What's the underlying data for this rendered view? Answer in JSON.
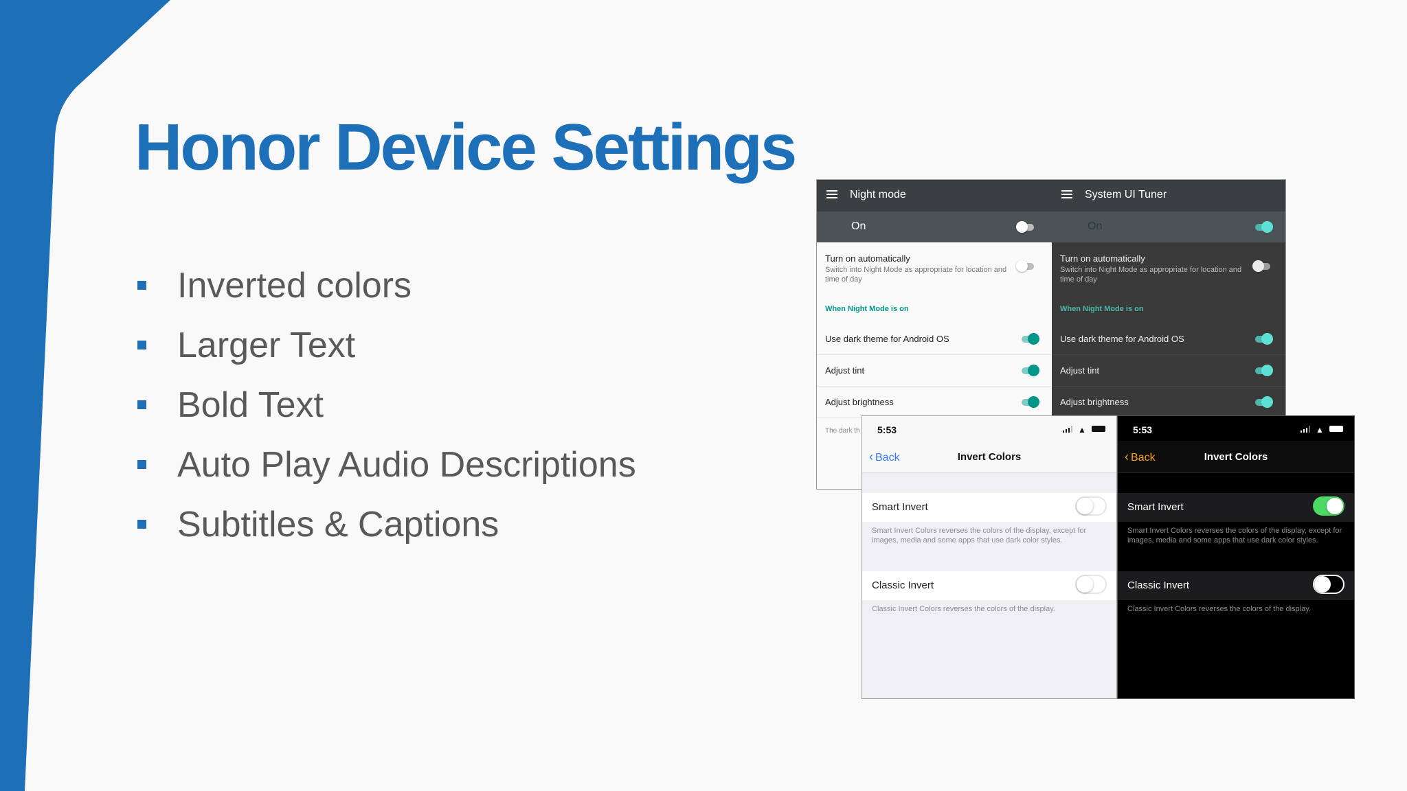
{
  "slide": {
    "title": "Honor Device Settings",
    "accent_color": "#1d6fb8",
    "bullets": [
      "Inverted colors",
      "Larger Text",
      "Bold Text",
      "Auto Play Audio Descriptions",
      "Subtitles & Captions"
    ]
  },
  "android": {
    "light": {
      "app_title": "Night mode",
      "on_label": "On",
      "auto_title": "Turn on automatically",
      "auto_desc": "Switch into Night Mode as appropriate for location and time of day",
      "section_header": "When Night Mode is on",
      "rows": [
        "Use dark theme for Android OS",
        "Adjust tint",
        "Adjust brightness"
      ],
      "footnote": "The dark th are normal"
    },
    "dark": {
      "app_title": "System UI Tuner",
      "on_label": "On",
      "auto_title": "Turn on automatically",
      "auto_desc": "Switch into Night Mode as appropriate for location and time of day",
      "section_header": "When Night Mode is on",
      "rows": [
        "Use dark theme for Android OS",
        "Adjust tint",
        "Adjust brightness"
      ]
    }
  },
  "ios": {
    "light": {
      "time": "5:53",
      "back_label": "Back",
      "nav_title": "Invert Colors",
      "smart_invert_label": "Smart Invert",
      "smart_invert_desc": "Smart Invert Colors reverses the colors of the display, except for images, media and some apps that use dark color styles.",
      "classic_invert_label": "Classic Invert",
      "classic_invert_desc": "Classic Invert Colors reverses the colors of the display."
    },
    "dark": {
      "time": "5:53",
      "back_label": "Back",
      "nav_title": "Invert Colors",
      "smart_invert_label": "Smart Invert",
      "smart_invert_desc": "Smart Invert Colors reverses the colors of the display, except for images, media and some apps that use dark color styles.",
      "classic_invert_label": "Classic Invert",
      "classic_invert_desc": "Classic Invert Colors reverses the colors of the display."
    }
  }
}
